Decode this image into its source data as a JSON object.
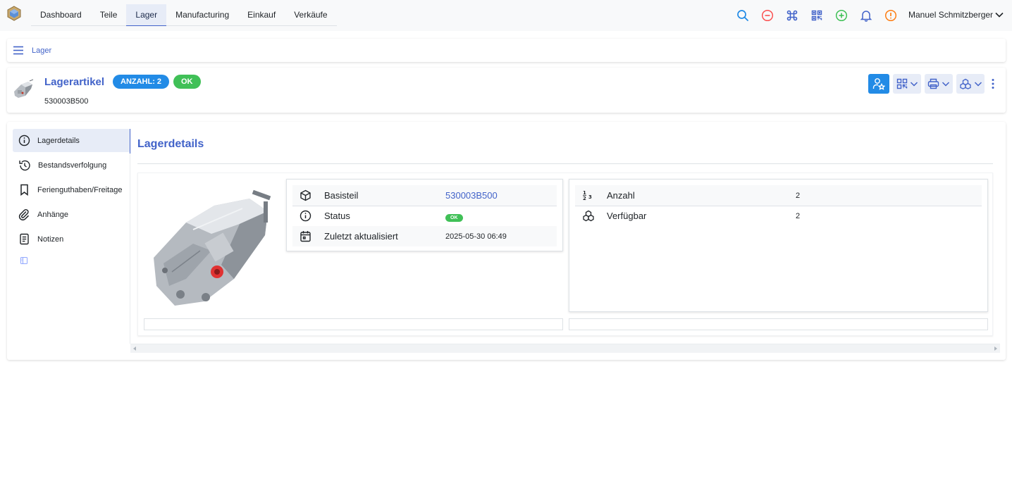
{
  "topbar": {
    "nav": [
      "Dashboard",
      "Teile",
      "Lager",
      "Manufacturing",
      "Einkauf",
      "Verkäufe"
    ],
    "active_nav": "Lager",
    "icons": [
      "search-icon",
      "minus-circle-icon",
      "command-icon",
      "qr-code-icon",
      "plus-circle-icon",
      "bell-icon",
      "alert-circle-icon"
    ],
    "user_name": "Manuel Schmitzberger"
  },
  "breadcrumb": {
    "label": "Lager"
  },
  "header": {
    "title": "Lagerartikel",
    "badge_count": "ANZAHL: 2",
    "badge_status": "OK",
    "ipn": "530003B500"
  },
  "sidebar": {
    "items": [
      {
        "label": "Lagerdetails",
        "icon": "info-circle-icon"
      },
      {
        "label": "Bestandsverfolgung",
        "icon": "history-icon"
      },
      {
        "label": "Ferienguthaben/Freitage",
        "icon": "bookmark-icon"
      },
      {
        "label": "Anhänge",
        "icon": "paperclip-icon"
      },
      {
        "label": "Notizen",
        "icon": "notes-icon"
      }
    ]
  },
  "details": {
    "section_title": "Lagerdetails",
    "left_table": [
      {
        "label": "Basisteil",
        "value": "530003B500",
        "icon": "cube-icon"
      },
      {
        "label": "Status",
        "value": "OK",
        "icon": "info-circle-icon"
      },
      {
        "label": "Zuletzt aktualisiert",
        "value": "2025-05-30 06:49",
        "icon": "calendar-icon"
      }
    ],
    "right_table": [
      {
        "label": "Anzahl",
        "value": "2",
        "icon": "numbers-icon"
      },
      {
        "label": "Verfügbar",
        "value": "2",
        "icon": "stack-icon"
      }
    ]
  },
  "colors": {
    "accent": "#4263c9",
    "primary": "#228be6",
    "success": "#40c057"
  }
}
